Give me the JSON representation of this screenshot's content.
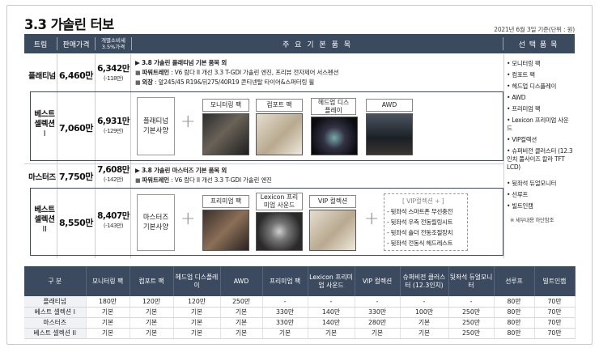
{
  "title": "3.3 가솔린 터보",
  "date": "2021년 6월 3일 기준(단위 : 원)",
  "header": {
    "trim": "트림",
    "price": "판매가격",
    "cost": "개별소비세 3.5%가격",
    "main": "주 요 기 본 품 목",
    "options": "선 택 품 목"
  },
  "platinum": {
    "name": "플래티넘",
    "price": "6,460만",
    "cost": "6,342만",
    "cost_diff": "(-118만)",
    "basic_title": "▶ 3.8 가솔린 플래티넘 기본 품목 외",
    "line1_label": "파워트레인",
    "line1_text": " : V6 람다 II 개선 3.3 T-GDI 가솔린 엔진, 프리뷰 전자제어 서스펜션",
    "line2_label": "외장",
    "line2_text": " : 앞245/45 R19&뒤275/40R19 콘티넨탈 타이어&스퍼터링 휠"
  },
  "best1": {
    "name1": "베스트",
    "name2": "셀렉션",
    "name3": "I",
    "price": "7,060만",
    "cost": "6,931만",
    "cost_diff": "(-129만)",
    "base_line1": "플래티넘",
    "base_line2": "기본사양",
    "options": [
      "모니터링 팩",
      "컴포트 팩",
      "헤드업 디스플레이",
      "AWD"
    ]
  },
  "masters": {
    "name": "마스터즈",
    "price": "7,750만",
    "cost": "7,608만",
    "cost_diff": "(-142만)",
    "basic_title": "▶ 3.8 가솔린 마스터즈 기본 품목 외",
    "line1_label": "파워트레인",
    "line1_text": " : V6 람다 II 개선 3.3 T-GDI 가솔린 엔진"
  },
  "best2": {
    "name1": "베스트",
    "name2": "셀렉션",
    "name3": "II",
    "price": "8,550만",
    "cost": "8,407만",
    "cost_diff": "(-143만)",
    "base_line1": "마스터즈",
    "base_line2": "기본사양",
    "options": [
      "프리미엄 팩",
      "Lexicon 프리미엄 사운드",
      "VIP 컬렉션"
    ],
    "vip_title": "[ VIP컬렉션 + ]",
    "vip_items": [
      "- 뒷좌석 스마트폰 무선충전",
      "- 뒷좌석 우측 전동릴링시트",
      "- 뒷좌석 숄더 전동조절장치",
      "- 뒷좌석 전동식 헤드레스트"
    ]
  },
  "side_options": [
    "모니터링 팩",
    "컴포트 팩",
    "헤드업 디스플레이",
    "AWD",
    "프리미엄 팩",
    "Lexicon 프리미엄 사운드",
    "VIP컬렉션",
    "슈퍼비전 클러스터 (12.3인치 풀사이즈 칼라 TFT LCD)",
    "뒷좌석 듀얼모니터",
    "선루프",
    "빌트인캠"
  ],
  "side_note": "※ 세부내용 하단참조",
  "table": {
    "headers": [
      "구 분",
      "모니터링 팩",
      "컴포트 팩",
      "헤드업 디스플레이",
      "AWD",
      "프리미엄 팩",
      "Lexicon 프리미엄 사운드",
      "VIP 컬렉션",
      "슈퍼비전 클러스터 (12.3인치)",
      "뒷좌석 듀얼모니터",
      "선루프",
      "빌트인캠"
    ],
    "rows": [
      [
        "플래티넘",
        "180만",
        "120만",
        "120만",
        "250만",
        "-",
        "-",
        "-",
        "-",
        "-",
        "80만",
        "70만"
      ],
      [
        "베스트 셀렉션 I",
        "기본",
        "기본",
        "기본",
        "기본",
        "330만",
        "140만",
        "330만",
        "100만",
        "250만",
        "80만",
        "70만"
      ],
      [
        "마스터즈",
        "기본",
        "기본",
        "기본",
        "기본",
        "330만",
        "140만",
        "280만",
        "기본",
        "250만",
        "80만",
        "70만"
      ],
      [
        "베스트 셀렉션 II",
        "기본",
        "기본",
        "기본",
        "기본",
        "기본",
        "기본",
        "기본",
        "기본",
        "250만",
        "80만",
        "70만"
      ]
    ]
  },
  "colors": {
    "header_bg": "#3b4a5e",
    "border": "#3b4a5e"
  }
}
